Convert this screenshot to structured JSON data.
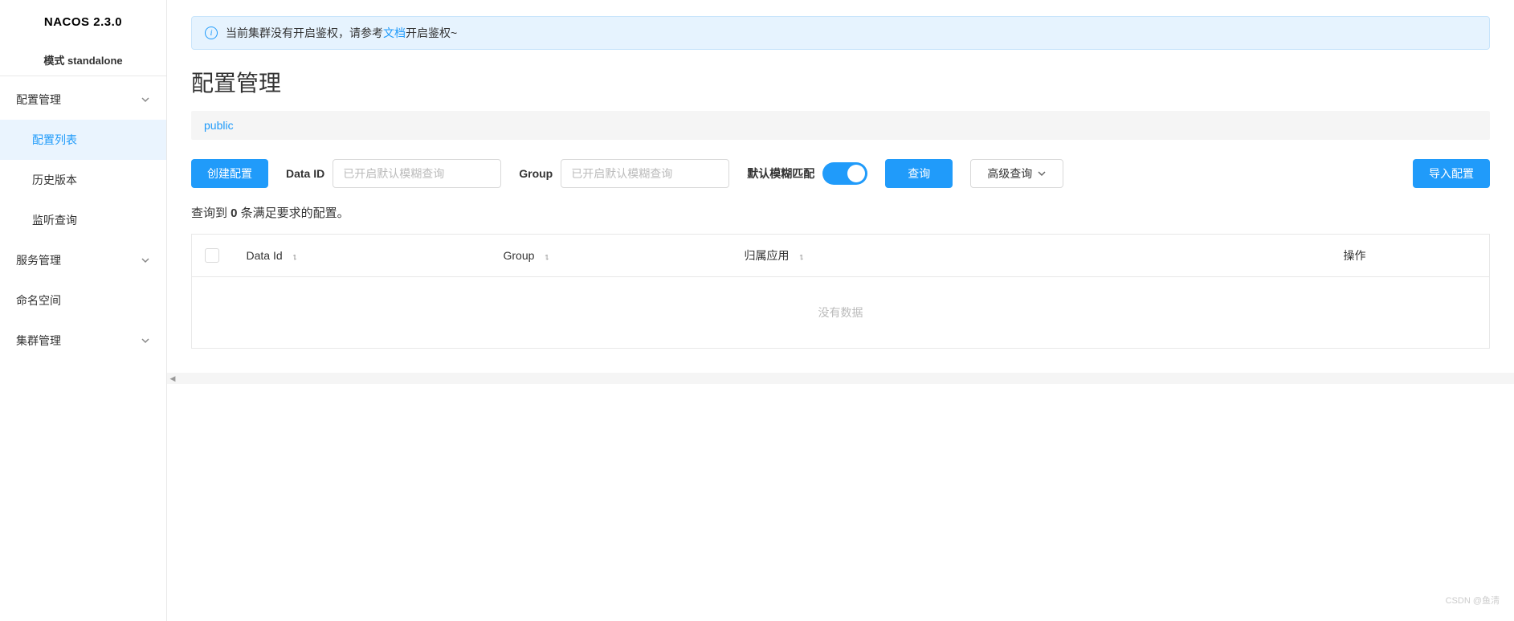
{
  "app": {
    "logo": "NACOS 2.3.0",
    "mode": "模式 standalone"
  },
  "sidebar": {
    "items": [
      {
        "label": "配置管理",
        "expandable": true
      },
      {
        "label": "配置列表",
        "sub": true,
        "active": true
      },
      {
        "label": "历史版本",
        "sub": true
      },
      {
        "label": "监听查询",
        "sub": true
      },
      {
        "label": "服务管理",
        "expandable": true
      },
      {
        "label": "命名空间"
      },
      {
        "label": "集群管理",
        "expandable": true
      }
    ]
  },
  "alert": {
    "text_before": "当前集群没有开启鉴权，请参考",
    "link_text": "文档",
    "text_after": "开启鉴权~"
  },
  "page": {
    "title": "配置管理",
    "namespace": "public"
  },
  "toolbar": {
    "create_label": "创建配置",
    "data_id_label": "Data ID",
    "data_id_placeholder": "已开启默认模糊查询",
    "group_label": "Group",
    "group_placeholder": "已开启默认模糊查询",
    "fuzzy_label": "默认模糊匹配",
    "query_label": "查询",
    "advanced_label": "高级查询",
    "import_label": "导入配置"
  },
  "result": {
    "prefix": "查询到 ",
    "count": "0",
    "suffix": " 条满足要求的配置。"
  },
  "table": {
    "columns": {
      "data_id": "Data Id",
      "group": "Group",
      "app": "归属应用",
      "action": "操作"
    },
    "empty": "没有数据"
  },
  "watermark": "CSDN @鱼淸"
}
